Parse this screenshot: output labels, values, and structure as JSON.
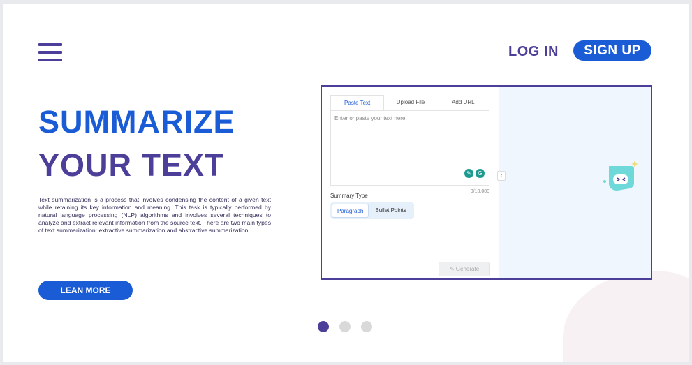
{
  "header": {
    "login_label": "LOG IN",
    "signup_label": "SIGN UP"
  },
  "hero": {
    "title_line1": "SUMMARIZE",
    "title_line2": "YOUR TEXT",
    "description": "Text summarization is a process that involves condensing the content of a given text while retaining its key information and meaning. This task is typically performed by natural language processing (NLP) algorithms and involves several techniques to analyze and extract relevant information from the source text. There are two main types of text summarization: extractive summarization and abstractive summarization.",
    "cta_label": "LEAN MORE"
  },
  "carousel": {
    "count": 3,
    "active_index": 0
  },
  "mockup": {
    "tabs": [
      "Paste Text",
      "Upload File",
      "Add URL"
    ],
    "active_tab": 0,
    "textarea_placeholder": "Enter or paste your text here",
    "counter": "0/10,000",
    "summary_label": "Summary Type",
    "summary_types": [
      "Paragraph",
      "Bullet Points"
    ],
    "active_summary_type": 0,
    "generate_label": "Generate",
    "collapse_icon": "‹"
  },
  "colors": {
    "primary_blue": "#1a5bd6",
    "brand_purple": "#4b3f9a",
    "robot_teal": "#6fd8d8"
  }
}
